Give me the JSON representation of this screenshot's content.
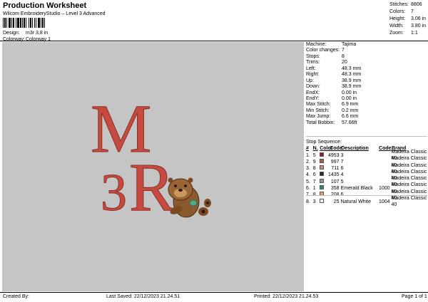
{
  "header": {
    "title": "Production Worksheet",
    "subtitle": "Wilcom EmbroideryStudio – Level 3 Advanced",
    "design_label": "Design:",
    "design_value": "m3r 3,8 in",
    "colorway_label": "Colorway:",
    "colorway_value": "Colorway 1"
  },
  "summary": [
    {
      "k": "Stitches:",
      "v": "8806"
    },
    {
      "k": "Colors:",
      "v": "7"
    },
    {
      "k": "Height:",
      "v": "3.06 in"
    },
    {
      "k": "Width:",
      "v": "3.80 in"
    },
    {
      "k": "Zoom:",
      "v": "1:1"
    }
  ],
  "properties": [
    {
      "k": "Machine:",
      "v": "Tajima"
    },
    {
      "k": "Color changes:",
      "v": "7"
    },
    {
      "k": "Stops:",
      "v": "8"
    },
    {
      "k": "Trims:",
      "v": "20"
    },
    {
      "k": "Left:",
      "v": "48.3 mm"
    },
    {
      "k": "Right:",
      "v": "48.3 mm"
    },
    {
      "k": "Up:",
      "v": "38.9 mm"
    },
    {
      "k": "Down:",
      "v": "38.9 mm"
    },
    {
      "k": "EndX:",
      "v": "0.00 in"
    },
    {
      "k": "EndY:",
      "v": "0.00 in"
    },
    {
      "k": "Max Stitch:",
      "v": "6.9 mm"
    },
    {
      "k": "Min Stitch:",
      "v": "0.2 mm"
    },
    {
      "k": "Max Jump:",
      "v": "6.6 mm"
    },
    {
      "k": "Total Bobbin:",
      "v": "57.66ft"
    }
  ],
  "stop_sequence": {
    "label": "Stop Sequence:",
    "headers": [
      "#",
      "N.",
      "Color",
      "Code",
      "Description",
      "Code",
      "Brand"
    ],
    "rows": [
      {
        "stop": "1.",
        "n": "5",
        "color": "#9b1b1b",
        "code": "4953",
        "desc": "3",
        "code2": "",
        "brand": "Madeira Classic 40"
      },
      {
        "stop": "2.",
        "n": "9",
        "color": "#b25a3a",
        "code": "997",
        "desc": "7",
        "code2": "",
        "brand": "Madeira Classic 40"
      },
      {
        "stop": "3.",
        "n": "8",
        "color": "#c2906a",
        "code": "711",
        "desc": "6",
        "code2": "",
        "brand": "Madeira Classic 40"
      },
      {
        "stop": "4.",
        "n": "6",
        "color": "#3a2418",
        "code": "1435",
        "desc": "4",
        "code2": "",
        "brand": "Madeira Classic 40"
      },
      {
        "stop": "5.",
        "n": "7",
        "color": "#8a9c94",
        "code": "107",
        "desc": "5",
        "code2": "",
        "brand": "Madeira Classic 40"
      },
      {
        "stop": "6.",
        "n": "1",
        "color": "#1f8f66",
        "code": "358",
        "desc": "Emerald Black",
        "code2": "1000",
        "brand": "Madeira Classic 40"
      },
      {
        "stop": "7.",
        "n": "8",
        "color": "#d6a27a",
        "code": "208",
        "desc": "6",
        "code2": "",
        "brand": "Madeira Classic 40"
      },
      {
        "stop": "8.",
        "n": "3",
        "color": "#f2f2ee",
        "code": "25",
        "desc": "Natural White",
        "code2": "1004",
        "brand": "Madeira Classic 40"
      }
    ]
  },
  "design": {
    "letter_top": "M",
    "digit": "3",
    "letter_bottom": "R",
    "letter_color": "#c54a3f",
    "otter_fur": "#8a5a2e",
    "otter_face": "#c99860"
  },
  "footer": {
    "created_by": "Created By:",
    "last_saved": "Last Saved: 22/12/2023 21.24.51",
    "printed": "Printed: 22/12/2023 21.24.53",
    "page": "Page 1 of 1"
  }
}
